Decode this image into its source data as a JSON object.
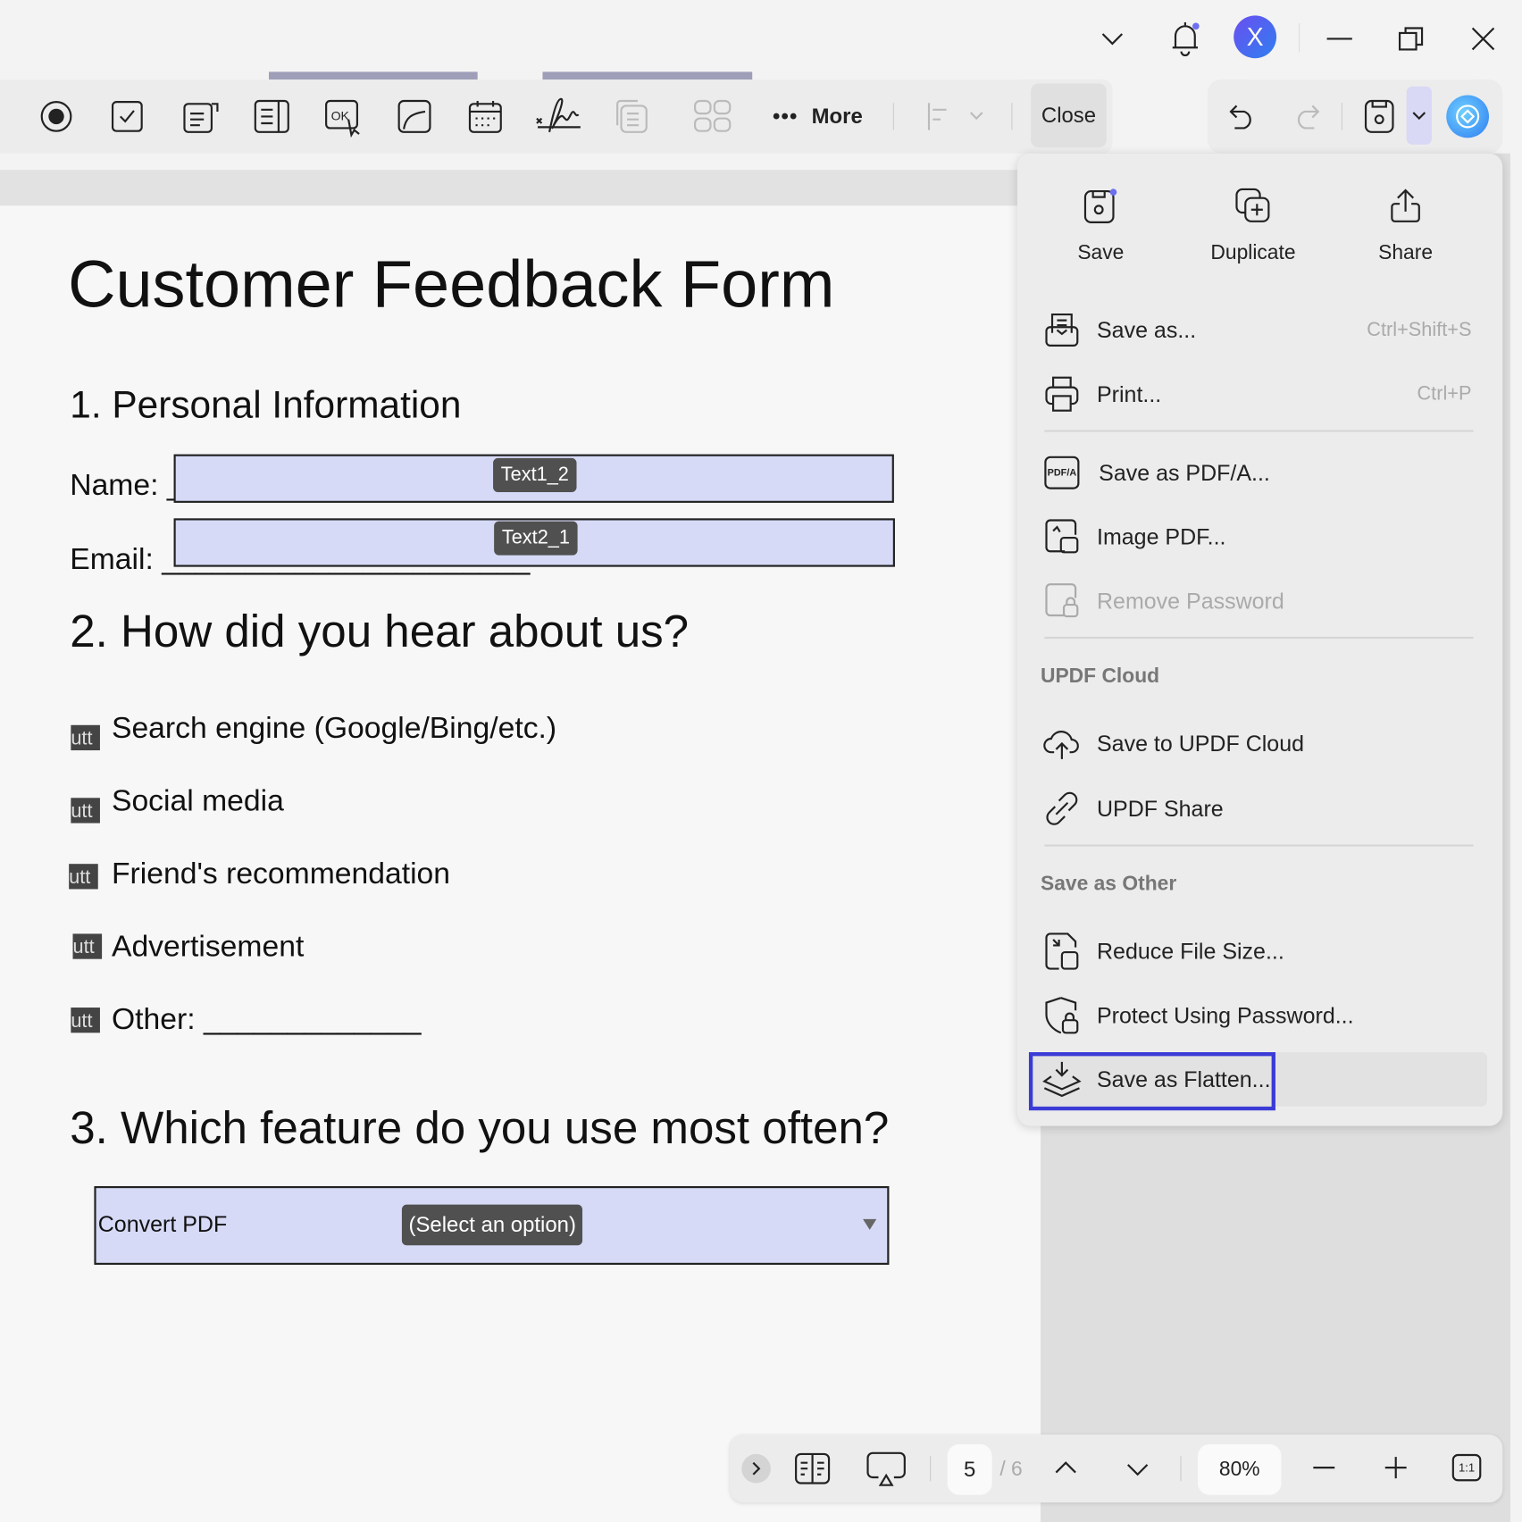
{
  "titlebar": {
    "avatar_letter": "X"
  },
  "toolbar": {
    "more_label": "More",
    "close_label": "Close"
  },
  "menu": {
    "top_actions": [
      {
        "label": "Save"
      },
      {
        "label": "Duplicate"
      },
      {
        "label": "Share"
      }
    ],
    "items": [
      {
        "label": "Save as...",
        "shortcut": "Ctrl+Shift+S"
      },
      {
        "label": "Print...",
        "shortcut": "Ctrl+P"
      },
      {
        "label": "Save as PDF/A..."
      },
      {
        "label": "Image PDF..."
      },
      {
        "label": "Remove Password",
        "disabled": true
      }
    ],
    "cloud_section": "UPDF Cloud",
    "cloud_items": [
      {
        "label": "Save to UPDF Cloud"
      },
      {
        "label": "UPDF Share"
      }
    ],
    "other_section": "Save as Other",
    "other_items": [
      {
        "label": "Reduce File Size..."
      },
      {
        "label": "Protect Using Password..."
      },
      {
        "label": "Save as Flatten...",
        "highlighted": true
      }
    ],
    "pdfa_icon_text": "PDF/A"
  },
  "document": {
    "title": "Customer Feedback Form",
    "section1": "1. Personal Information",
    "name_label": "Name: _",
    "email_label": "Email: ______________________",
    "name_field_tag": "Text1_2",
    "email_field_tag": "Text2_1",
    "section2": "2. How did you hear about us?",
    "checkbox_text": "utt",
    "options": [
      "Search engine (Google/Bing/etc.)",
      "Social media",
      "Friend's recommendation",
      "Advertisement",
      "Other: _____________"
    ],
    "section3": "3. Which feature do you use most often?",
    "dropdown_value": "Convert PDF",
    "dropdown_tag": "(Select an option)"
  },
  "bottombar": {
    "page_current": "5",
    "page_total": "/ 6",
    "zoom": "80%",
    "actual_size": "1:1"
  },
  "colors": {
    "accent": "#3b3bd6",
    "field": "#d6daf6",
    "avatar": "#5b4ff0"
  }
}
